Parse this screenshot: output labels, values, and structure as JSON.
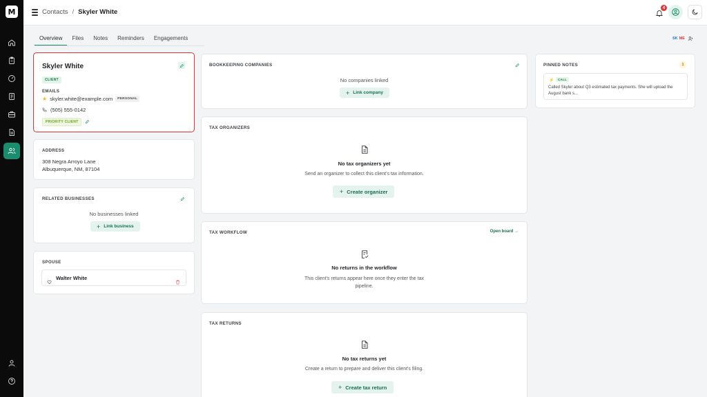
{
  "app": {
    "logo_text": "M"
  },
  "topbar": {
    "breadcrumb": [
      "Contacts",
      "/",
      "Skyler White"
    ],
    "notification_count": "4"
  },
  "tabs": [
    "Overview",
    "Files",
    "Notes",
    "Reminders",
    "Engagements"
  ],
  "active_tab": "Overview",
  "user_chip": {
    "initials_1": "SK",
    "initials_2": "ME"
  },
  "profile": {
    "name": "Skyler White",
    "type_badge": "CLIENT",
    "emails_label": "EMAILS",
    "email": "skyler.white@example.com",
    "email_tag": "PERSONAL",
    "phone": "(505) 555-0142",
    "tag": "PRIORITY CLIENT"
  },
  "address": {
    "label": "ADDRESS",
    "line1": "308 Negra Arroyo Lane",
    "line2": "Albuquerque, NM, 87104"
  },
  "related_businesses": {
    "label": "RELATED BUSINESSES",
    "empty": "No businesses linked",
    "button": "Link business"
  },
  "spouse": {
    "label": "SPOUSE",
    "name": "Walter White"
  },
  "bookkeeping": {
    "label": "BOOKKEEPING COMPANIES",
    "empty": "No companies linked",
    "button": "Link company"
  },
  "tax_organizers": {
    "label": "TAX ORGANIZERS",
    "empty_title": "No tax organizers yet",
    "empty_desc": "Send an organizer to collect this client's tax information.",
    "button": "Create organizer"
  },
  "tax_workflow": {
    "label": "TAX WORKFLOW",
    "link": "Open board →",
    "empty_title": "No returns in the workflow",
    "empty_desc_1": "This client's returns appear here once they enter the tax",
    "empty_desc_2": "pipeline."
  },
  "tax_returns": {
    "label": "TAX RETURNS",
    "empty_title": "No tax returns yet",
    "empty_desc": "Create a return to prepare and deliver this client's filing.",
    "button": "Create tax return"
  },
  "pinned_notes": {
    "label": "PINNED NOTES",
    "count": "1",
    "note_type": "CALL",
    "note_text": "Called Skyler about Q3 estimated tax payments. She will upload the August bank s..."
  },
  "colors": {
    "accent": "#1a8d6f",
    "highlight": "#e0312f",
    "rail": "#0b0b0b"
  },
  "icons": {
    "rail": [
      "home-icon",
      "clipboard-icon",
      "dashboard-icon",
      "checklist-icon",
      "briefcase-icon",
      "document-icon",
      "users-icon",
      "account-icon",
      "help-icon"
    ]
  }
}
